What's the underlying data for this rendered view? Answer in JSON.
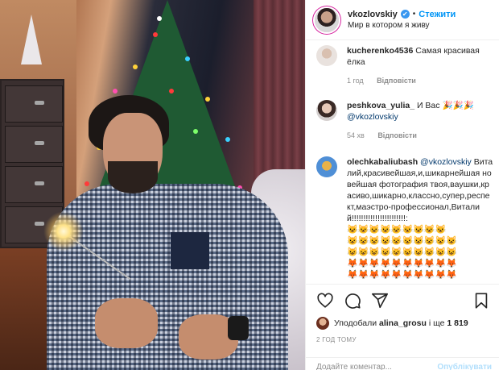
{
  "post": {
    "username": "vkozlovskiy",
    "verified_glyph": "✔",
    "dot": "•",
    "follow_label": "Стежити",
    "location": "Мир в котором я живу"
  },
  "comments": [
    {
      "user": "kucherenko4536",
      "text": "Самая красивая ёлка",
      "time": "1 год",
      "reply": "Відповісти",
      "avatar_icon": "user-avatar-icon"
    },
    {
      "user": "peshkova_yulia_",
      "text_before": "И Вас",
      "emojis": "🎉🎉🎉",
      "mention": "@vkozlovskiy",
      "time": "54 хв",
      "reply": "Відповісти",
      "avatar_icon": "user-avatar-icon"
    },
    {
      "user": "olechkabaliubash",
      "mention": "@vkozlovskiy",
      "text": "Виталий,красивейшая,и,шикарнейшая новейшая фотография твоя,ваушки,красиво,шикарно,классно,супер,респект,маэстро-профессионал,Виталий!!!!!!!!!!!!!!!!!!!!!!!:",
      "emoji_line_1": "😺😺😺😺😺😺😺😺😺",
      "emoji_line_2": "😺😺😺😺😺😺😺😺😺😺",
      "emoji_line_3": "😺😺😺😺😺😺😺😺😺😺",
      "emoji_line_4": "🦊🦊🦊🦊🦊🦊🦊🦊🦊🦊",
      "emoji_line_5": "🦊🦊🦊🦊🦊🦊🦊🦊🦊🦊",
      "avatar_icon": "user-avatar-icon"
    }
  ],
  "actions": {
    "like_icon": "heart-icon",
    "comment_icon": "comment-icon",
    "share_icon": "share-icon",
    "save_icon": "bookmark-icon"
  },
  "likes": {
    "prefix": "Уподобали",
    "user": "alina_grosu",
    "suffix": "і ще",
    "count": "1 819"
  },
  "timestamp": "2 ГОД ТОМУ",
  "add_comment": {
    "placeholder": "Додайте коментар...",
    "publish_label": "Опублікувати"
  },
  "colors": {
    "accent": "#0095f6",
    "muted": "#8e8e8e",
    "border": "#efefef"
  }
}
